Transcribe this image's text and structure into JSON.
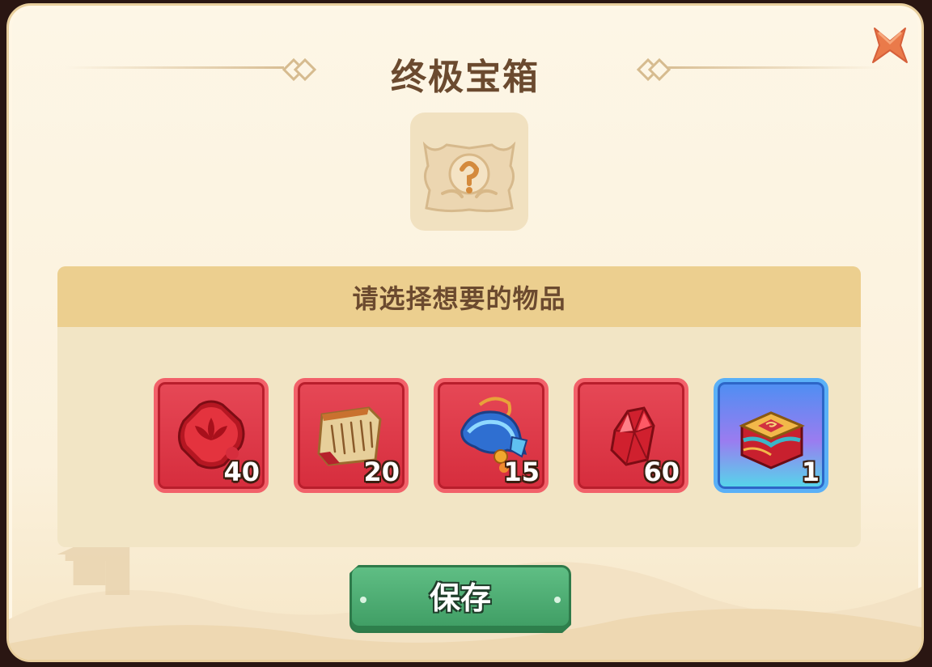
{
  "dialog": {
    "title": "终极宝箱",
    "close_icon": "close-x-icon",
    "chest_icon": "ultimate-chest-icon"
  },
  "selection": {
    "header": "请选择想要的物品",
    "items": [
      {
        "icon": "red-lotus-emblem-icon",
        "count": "40",
        "rarity": "red"
      },
      {
        "icon": "ancient-scroll-icon",
        "count": "20",
        "rarity": "red"
      },
      {
        "icon": "blue-artifact-pouch-icon",
        "count": "15",
        "rarity": "red"
      },
      {
        "icon": "red-crystal-icon",
        "count": "60",
        "rarity": "red"
      },
      {
        "icon": "ornate-treasure-box-icon",
        "count": "1",
        "rarity": "blue"
      }
    ]
  },
  "actions": {
    "save_label": "保存"
  },
  "colors": {
    "title": "#6b4a2f",
    "panel_header": "#eccf8f",
    "red_slot": "#d62d3d",
    "blue_slot": "#4d8ff2",
    "save_button": "#4aa86f"
  }
}
